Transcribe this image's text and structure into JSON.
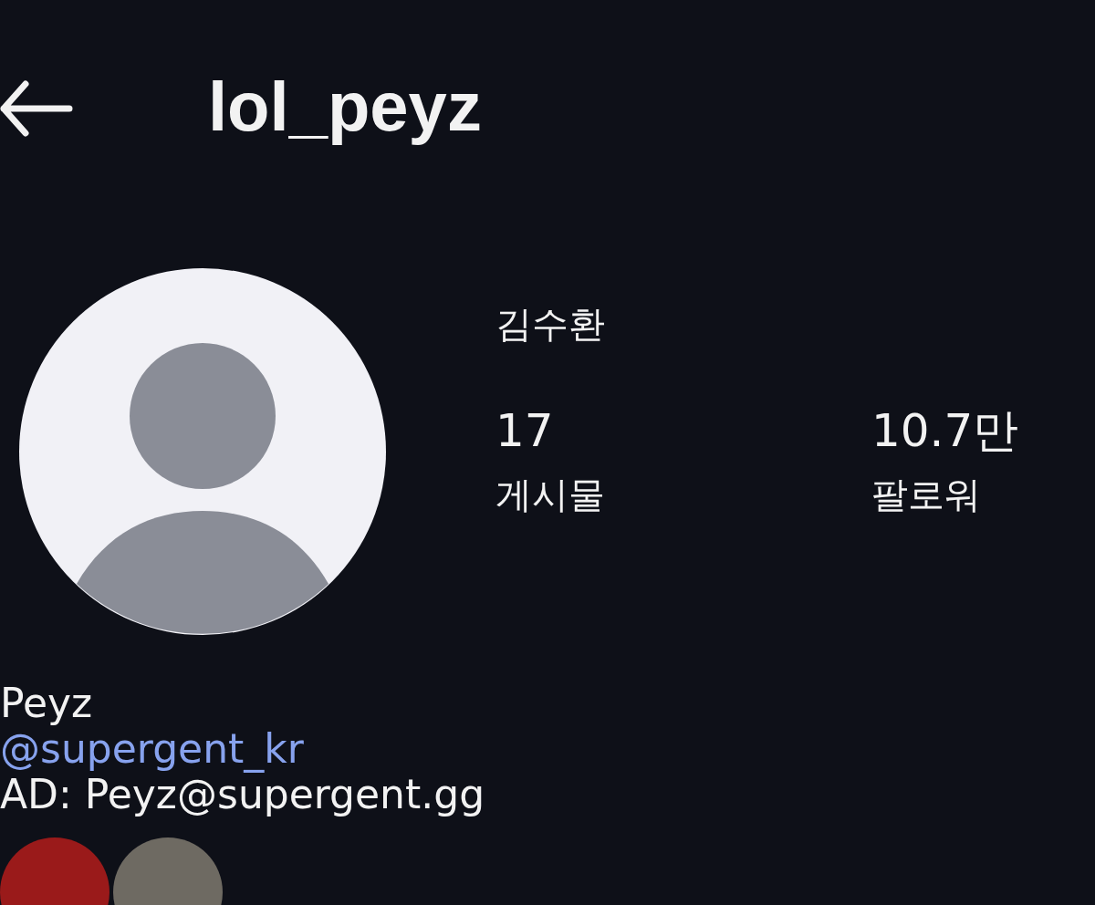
{
  "header": {
    "title": "lol_peyz"
  },
  "profile": {
    "full_name": "김수환",
    "stats": [
      {
        "value": "17",
        "label": "게시물"
      },
      {
        "value": "10.7만",
        "label": "팔로워"
      }
    ]
  },
  "bio": [
    {
      "kind": "name",
      "text": "Peyz"
    },
    {
      "kind": "link",
      "text": "@supergent_kr"
    },
    {
      "kind": "text",
      "text": "AD: Peyz@supergent.gg"
    }
  ],
  "highlights": [
    {
      "color": "#9a1a1a"
    },
    {
      "color": "#6e6a62"
    }
  ]
}
